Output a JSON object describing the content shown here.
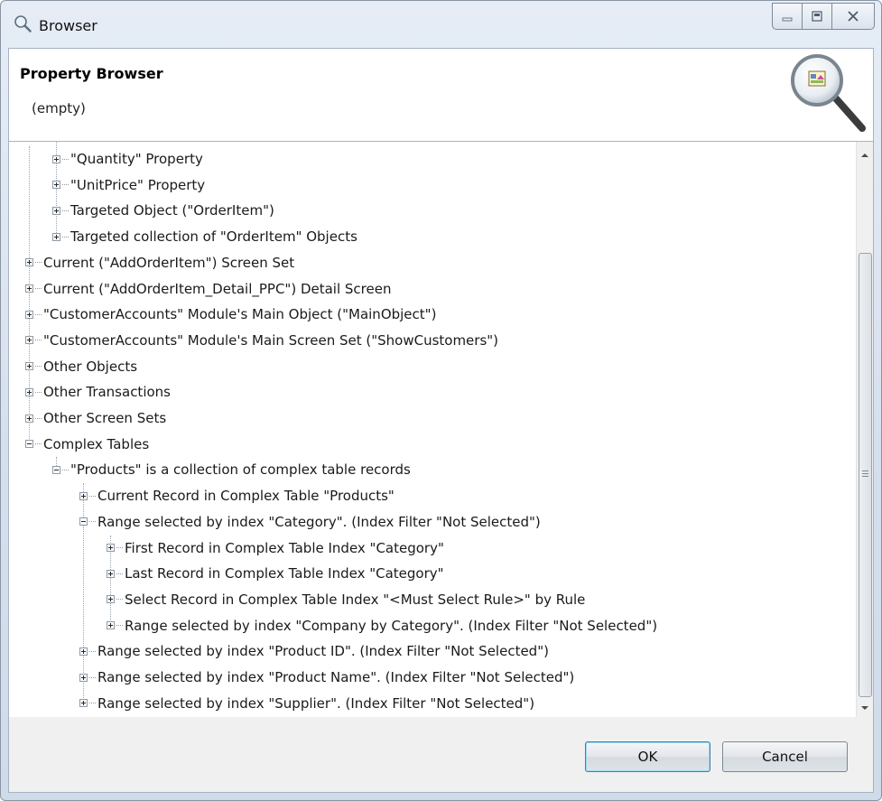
{
  "window": {
    "title": "Browser"
  },
  "header": {
    "title": "Property Browser",
    "subtitle": "(empty)"
  },
  "tree": {
    "items": [
      {
        "label": "\"Quantity\" Property",
        "level": 1,
        "expanded": false
      },
      {
        "label": "\"UnitPrice\" Property",
        "level": 1,
        "expanded": false
      },
      {
        "label": "Targeted Object (\"OrderItem\")",
        "level": 1,
        "expanded": false
      },
      {
        "label": "Targeted collection of \"OrderItem\" Objects",
        "level": 1,
        "expanded": false
      },
      {
        "label": "Current (\"AddOrderItem\") Screen Set",
        "level": 0,
        "expanded": false
      },
      {
        "label": "Current (\"AddOrderItem_Detail_PPC\") Detail Screen",
        "level": 0,
        "expanded": false
      },
      {
        "label": "\"CustomerAccounts\" Module's Main Object (\"MainObject\")",
        "level": 0,
        "expanded": false
      },
      {
        "label": "\"CustomerAccounts\" Module's Main Screen Set (\"ShowCustomers\")",
        "level": 0,
        "expanded": false
      },
      {
        "label": "Other Objects",
        "level": 0,
        "expanded": false
      },
      {
        "label": "Other Transactions",
        "level": 0,
        "expanded": false
      },
      {
        "label": "Other Screen Sets",
        "level": 0,
        "expanded": false
      },
      {
        "label": "Complex Tables",
        "level": 0,
        "expanded": true
      },
      {
        "label": "\"Products\" is a collection of complex table records",
        "level": 1,
        "expanded": true
      },
      {
        "label": "Current Record in Complex Table \"Products\"",
        "level": 2,
        "expanded": false
      },
      {
        "label": "Range selected by index \"Category\". (Index Filter \"Not Selected\")",
        "level": 2,
        "expanded": true
      },
      {
        "label": "First Record in Complex Table Index \"Category\"",
        "level": 3,
        "expanded": false
      },
      {
        "label": "Last Record in Complex Table Index \"Category\"",
        "level": 3,
        "expanded": false
      },
      {
        "label": "Select Record in Complex Table Index \"<Must Select Rule>\" by Rule",
        "level": 3,
        "expanded": false
      },
      {
        "label": "Range selected by index \"Company by Category\". (Index Filter \"Not Selected\")",
        "level": 3,
        "expanded": false
      },
      {
        "label": "Range selected by index \"Product ID\". (Index Filter \"Not Selected\")",
        "level": 2,
        "expanded": false
      },
      {
        "label": "Range selected by index \"Product Name\". (Index Filter \"Not Selected\")",
        "level": 2,
        "expanded": false
      },
      {
        "label": "Range selected by index \"Supplier\". (Index Filter \"Not Selected\")",
        "level": 2,
        "expanded": false
      }
    ]
  },
  "buttons": {
    "ok": "OK",
    "cancel": "Cancel"
  }
}
